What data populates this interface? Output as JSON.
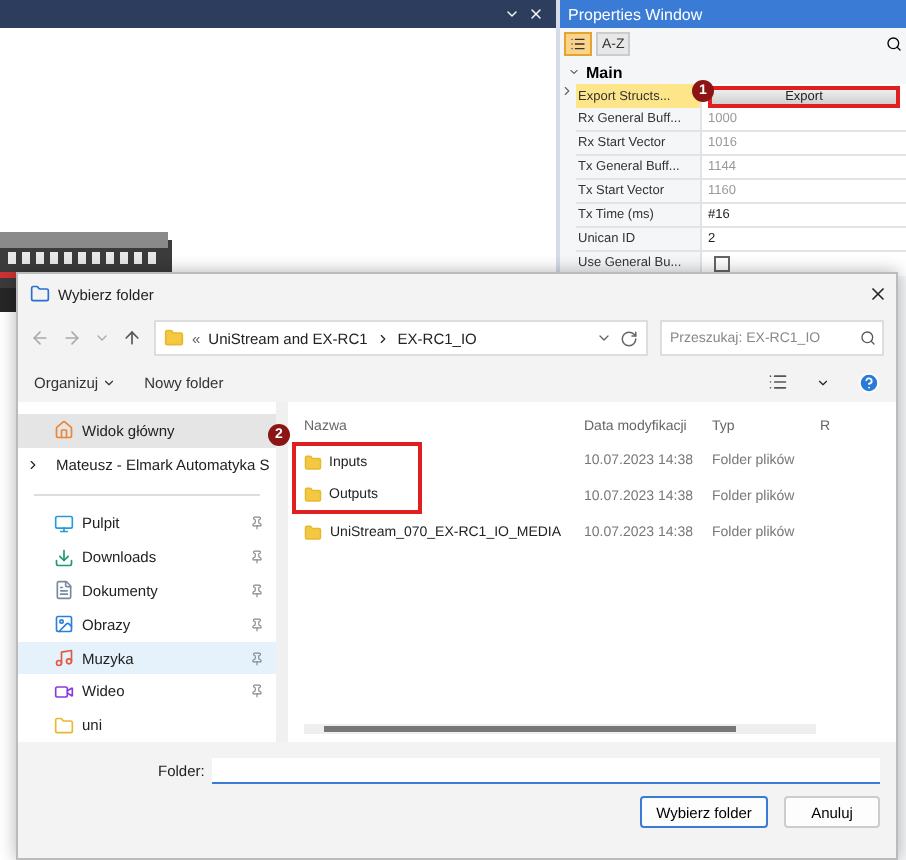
{
  "properties": {
    "title": "Properties Window",
    "toolbar": [
      {
        "kind": "categorized",
        "selected": true
      },
      {
        "kind": "alpha",
        "label": "A-Z",
        "selected": false
      }
    ],
    "section": {
      "label": "Main",
      "expanded": true
    },
    "rows": [
      {
        "kind": "button",
        "name": "Export Structs...",
        "value": "Export",
        "selected": true,
        "callout": "1"
      },
      {
        "kind": "text",
        "name": "Rx General Buff...",
        "value": "1000",
        "disabled": true,
        "selected": false
      },
      {
        "kind": "text",
        "name": "Rx Start Vector",
        "value": "1016",
        "disabled": true,
        "selected": false
      },
      {
        "kind": "text",
        "name": "Tx General Buff...",
        "value": "1144",
        "disabled": true,
        "selected": false
      },
      {
        "kind": "text",
        "name": "Tx Start Vector",
        "value": "1160",
        "disabled": true,
        "selected": false
      },
      {
        "kind": "text",
        "name": "Tx Time (ms)",
        "value": "#16",
        "disabled": false,
        "selected": false
      },
      {
        "kind": "text",
        "name": "Unican ID",
        "value": "2",
        "disabled": false,
        "selected": false
      },
      {
        "kind": "checkbox",
        "name": "Use General Bu...",
        "checked": false,
        "selected": false
      }
    ]
  },
  "dialog": {
    "title": "Wybierz folder",
    "address_overflow": "«",
    "address": [
      "UniStream and EX-RC1",
      "EX-RC1_IO"
    ],
    "search": {
      "placeholder": "Przeszukaj: EX-RC1_IO"
    },
    "toolbar": {
      "organize": "Organizuj",
      "new_folder": "Nowy folder"
    },
    "nav": [
      {
        "kind": "home",
        "label": "Widok główny",
        "selected": true,
        "hovered": false,
        "pinned": false,
        "expandable": false
      },
      {
        "kind": "cloud",
        "label": "Mateusz - Elmark Automatyka S",
        "selected": false,
        "hovered": false,
        "pinned": false,
        "expandable": true
      },
      {
        "kind": "desktop",
        "label": "Pulpit",
        "selected": false,
        "hovered": false,
        "pinned": true,
        "expandable": false
      },
      {
        "kind": "downloads",
        "label": "Downloads",
        "selected": false,
        "hovered": false,
        "pinned": true,
        "expandable": false
      },
      {
        "kind": "documents",
        "label": "Dokumenty",
        "selected": false,
        "hovered": false,
        "pinned": true,
        "expandable": false
      },
      {
        "kind": "pictures",
        "label": "Obrazy",
        "selected": false,
        "hovered": false,
        "pinned": true,
        "expandable": false
      },
      {
        "kind": "music",
        "label": "Muzyka",
        "selected": false,
        "hovered": true,
        "pinned": true,
        "expandable": false
      },
      {
        "kind": "videos",
        "label": "Wideo",
        "selected": false,
        "hovered": false,
        "pinned": true,
        "expandable": false
      },
      {
        "kind": "folder",
        "label": "uni",
        "selected": false,
        "hovered": false,
        "pinned": false,
        "expandable": false
      }
    ],
    "columns": [
      "Nazwa",
      "Data modyfikacji",
      "Typ",
      "R"
    ],
    "files_callout": "2",
    "files": [
      {
        "name": "Inputs",
        "modified": "10.07.2023 14:38",
        "type": "Folder plików",
        "highlighted": true
      },
      {
        "name": "Outputs",
        "modified": "10.07.2023 14:38",
        "type": "Folder plików",
        "highlighted": true
      },
      {
        "name": "UniStream_070_EX-RC1_IO_MEDIA",
        "modified": "10.07.2023 14:38",
        "type": "Folder plików",
        "highlighted": false
      }
    ],
    "folder_label": "Folder:",
    "buttons": [
      {
        "label": "Wybierz folder",
        "primary": true
      },
      {
        "label": "Anuluj",
        "primary": false
      }
    ]
  }
}
